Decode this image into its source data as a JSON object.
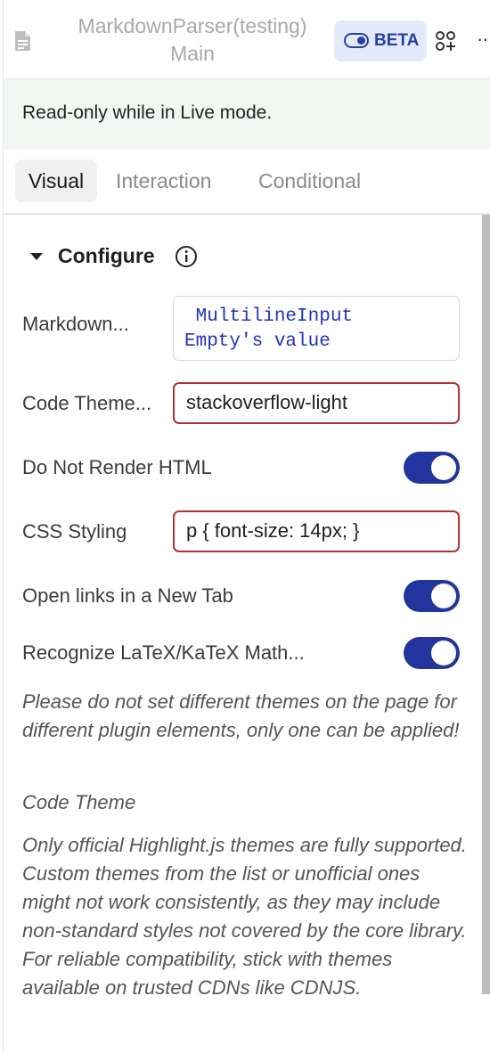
{
  "header": {
    "title": "MarkdownParser(testing)",
    "subtitle": "Main",
    "beta_label": "BETA",
    "more_label": "··"
  },
  "notice": "Read-only while in Live mode.",
  "tabs": [
    {
      "label": "Visual",
      "active": true
    },
    {
      "label": "Interaction",
      "active": false
    },
    {
      "label": "Conditional",
      "active": false
    }
  ],
  "section": {
    "title": "Configure"
  },
  "fields": {
    "markdown": {
      "label": "Markdown...",
      "value": " MultilineInput\nEmpty's value"
    },
    "code_theme": {
      "label": "Code Theme...",
      "value": "stackoverflow-light"
    },
    "do_not_render_html": {
      "label": "Do Not Render HTML",
      "on": true
    },
    "css_styling": {
      "label": "CSS Styling",
      "value": "p { font-size: 14px; }"
    },
    "open_links_new_tab": {
      "label": "Open links in a New Tab",
      "on": true
    },
    "recognize_latex": {
      "label": "Recognize LaTeX/KaTeX Math...",
      "on": true
    }
  },
  "help": {
    "themes_note": "Please do not set different themes on the page for different plugin elements, only one can be applied!",
    "code_theme_heading": "Code Theme",
    "code_theme_note": "Only official Highlight.js themes are fully supported. Custom themes from the list or unofficial ones might not work consistently, as they may include non-standard styles not covered by the core library. For reliable compatibility, stick with themes available on trusted CDNs like CDNJS."
  },
  "colors": {
    "accent": "#22349e",
    "beta_bg": "#e3ebfb",
    "error_border": "#b33030",
    "code_text": "#2433b8",
    "notice_bg": "#f3f7f3"
  },
  "icons": {
    "doc": "document-icon",
    "beta": "toggle-icon",
    "grid": "add-component-icon",
    "more": "more-icon",
    "caret": "caret-down-icon",
    "info": "info-icon"
  }
}
